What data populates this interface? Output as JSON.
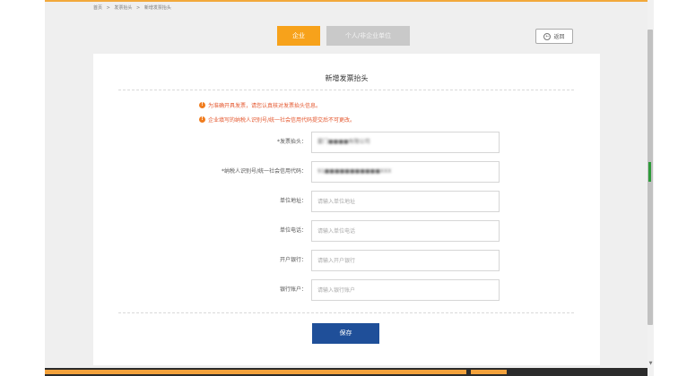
{
  "breadcrumb": {
    "home": "首页",
    "sep1": ">",
    "invoice_title": "发票抬头",
    "sep2": ">",
    "current": "新增发票抬头"
  },
  "tabs": {
    "company": "企业",
    "personal": "个人/非企业单位"
  },
  "back_button": {
    "label": "返回"
  },
  "form": {
    "title": "新增发票抬头",
    "notices": [
      "为准确开具发票，请您认真核对发票抬头信息。",
      "企业填写的纳税人识别号/统一社会信用代码提交后不可更改。"
    ],
    "fields": [
      {
        "label": "*发票抬头：",
        "value": "厦门■■■■有限公司",
        "placeholder": ""
      },
      {
        "label": "*纳税人识别号/统一社会信用代码：",
        "value": "91■■■■■■■■■■■XXX",
        "placeholder": ""
      },
      {
        "label": "单位地址：",
        "value": "",
        "placeholder": "请输入单位地址"
      },
      {
        "label": "单位电话：",
        "value": "",
        "placeholder": "请输入单位电话"
      },
      {
        "label": "开户银行：",
        "value": "",
        "placeholder": "请输入开户银行"
      },
      {
        "label": "银行账户：",
        "value": "",
        "placeholder": "请输入银行账户"
      }
    ],
    "save_label": "保存"
  },
  "colors": {
    "accent_orange": "#f7a21b",
    "save_blue": "#1f4f99",
    "notice_red": "#e4572e"
  }
}
